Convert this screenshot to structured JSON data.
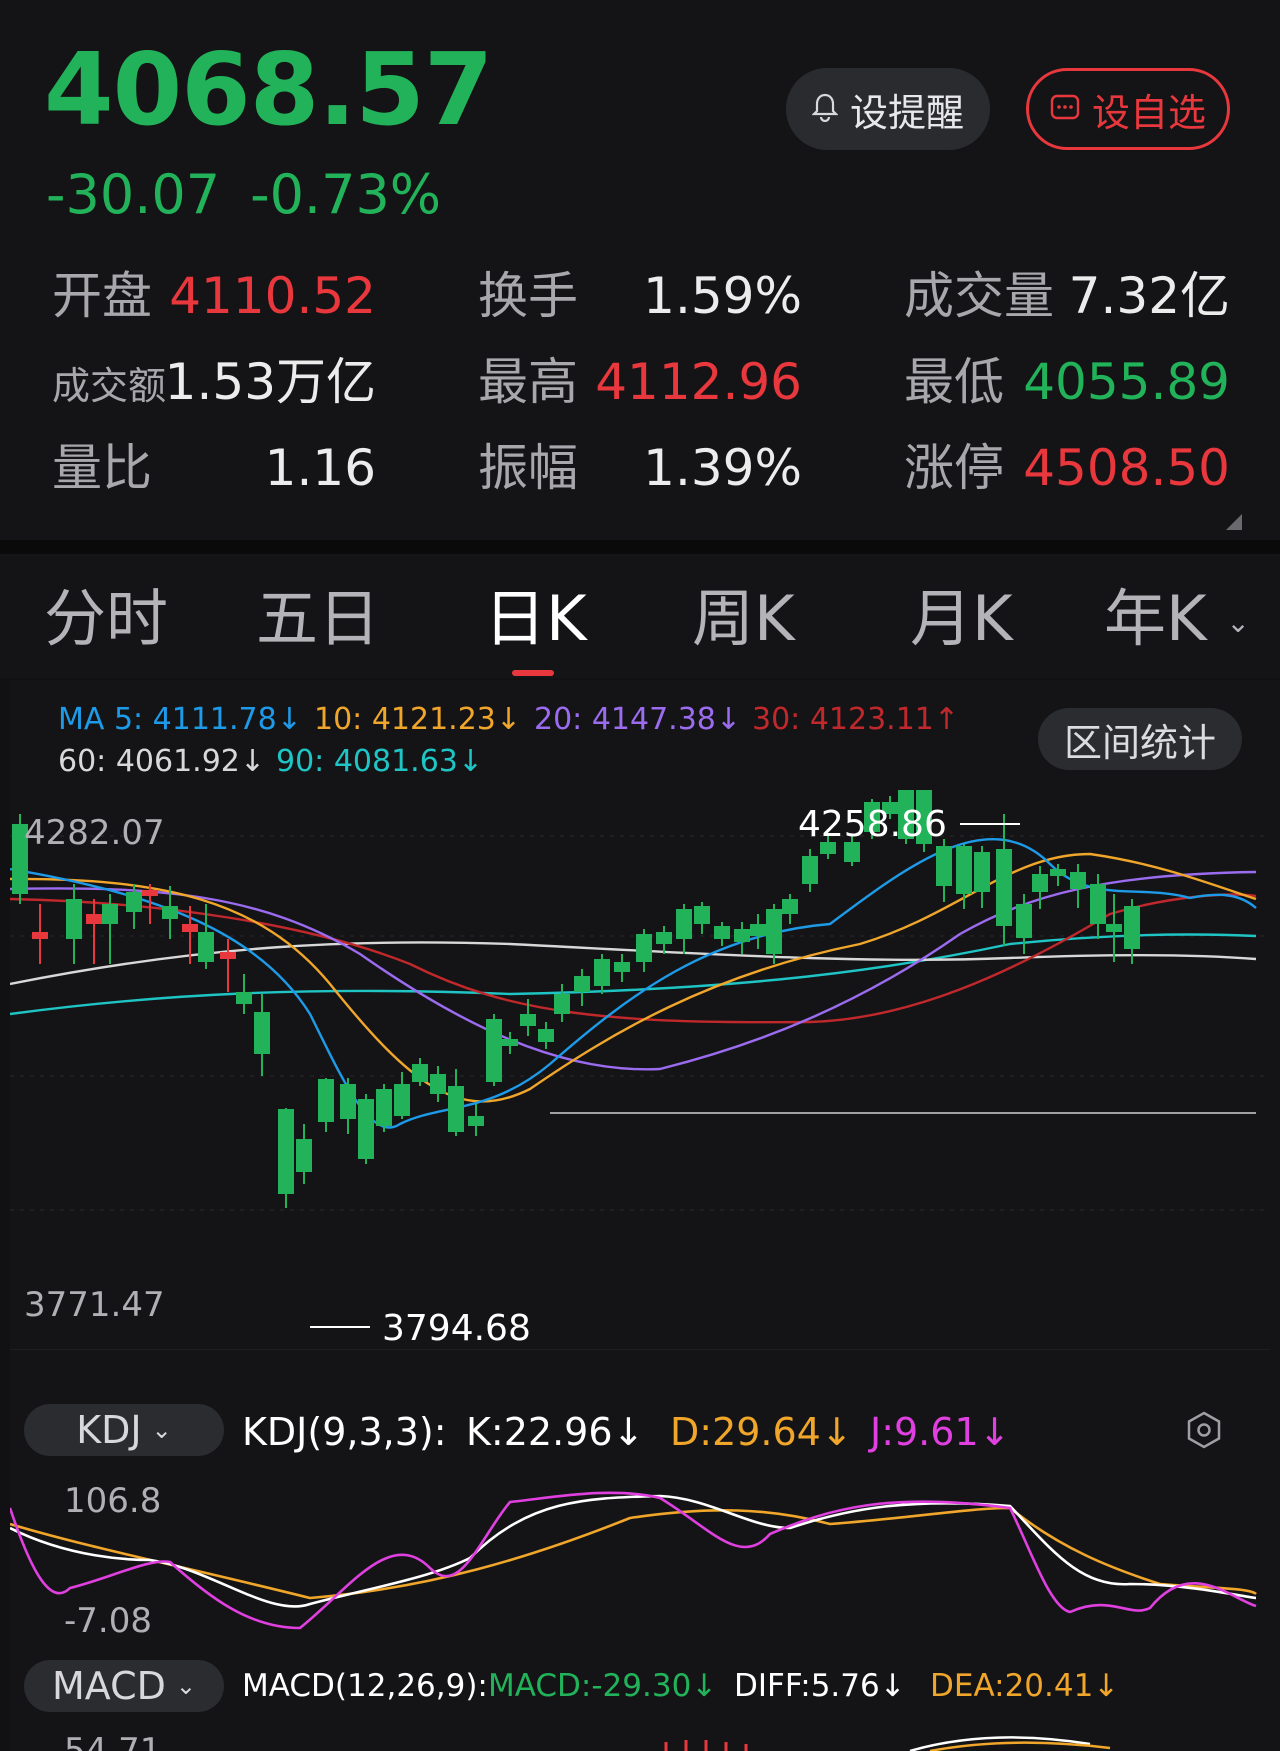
{
  "quote": {
    "price": "4068.57",
    "change": "-30.07",
    "change_pct": "-0.73%"
  },
  "buttons": {
    "alert_label": "设提醒",
    "watch_label": "设自选",
    "range_label": "区间统计"
  },
  "stats": [
    {
      "label": "开盘",
      "value": "4110.52",
      "tone": "red"
    },
    {
      "label": "换手",
      "value": "1.59%",
      "tone": "white"
    },
    {
      "label": "成交量",
      "value": "7.32亿",
      "tone": "white"
    },
    {
      "label": "成交额",
      "value": "1.53万亿",
      "tone": "white"
    },
    {
      "label": "最高",
      "value": "4112.96",
      "tone": "red"
    },
    {
      "label": "最低",
      "value": "4055.89",
      "tone": "green"
    },
    {
      "label": "量比",
      "value": "1.16",
      "tone": "white"
    },
    {
      "label": "振幅",
      "value": "1.39%",
      "tone": "white"
    },
    {
      "label": "涨停",
      "value": "4508.50",
      "tone": "red"
    }
  ],
  "tabs": [
    "分时",
    "五日",
    "日K",
    "周K",
    "月K",
    "年K"
  ],
  "active_tab": "日K",
  "ma_legend": {
    "ma5": "MA 5: 4111.78↓",
    "ma10": "10: 4121.23↓",
    "ma20": "20: 4147.38↓",
    "ma30": "30: 4123.11↑",
    "ma60": "60: 4061.92↓",
    "ma90": "90: 4081.63↓"
  },
  "colors": {
    "up": "#e8383d",
    "down": "#22b35a",
    "ma5": "#1e9be8",
    "ma10": "#f0a62a",
    "ma20": "#9b6cf0",
    "ma30": "#c0282c",
    "ma60": "#d8d8d8",
    "ma90": "#1fc4c4",
    "kdj_k": "#ffffff",
    "kdj_d": "#f0a62a",
    "kdj_j": "#e040e0"
  },
  "chart_data": {
    "type": "candlestick",
    "axis_top_label": "4282.07",
    "axis_bottom_label": "3771.47",
    "high_marker": "4258.86",
    "low_marker": "3794.68",
    "ylim": [
      3771.47,
      4282.07
    ]
  },
  "kdj": {
    "selector": "KDJ",
    "title": "KDJ(9,3,3):",
    "k": "K:22.96↓",
    "d": "D:29.64↓",
    "j": "J:9.61↓",
    "top_label": "106.8",
    "bottom_label": "-7.08"
  },
  "macd": {
    "selector": "MACD",
    "title": "MACD(12,26,9):",
    "macd": "MACD:-29.30↓",
    "diff": "DIFF:5.76↓",
    "dea": "DEA:20.41↓",
    "top_label": "54.71"
  }
}
